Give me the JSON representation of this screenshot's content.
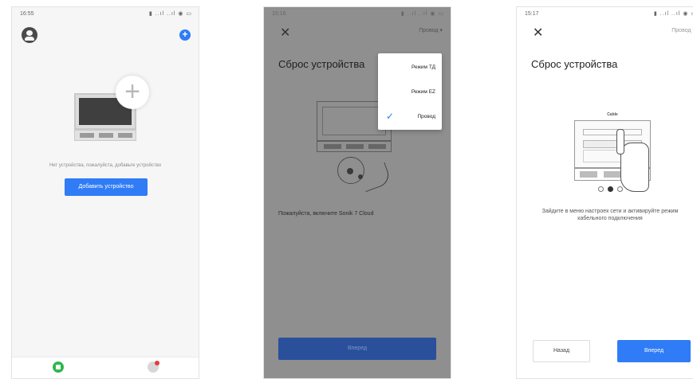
{
  "phone1": {
    "status": {
      "time": "16:55",
      "icons": "▮ ..ıl ..ıl ◉ ▭"
    },
    "empty_text": "Нет устройства, пожалуйста, добавьте устройство",
    "add_device_label": "Добавить устройство",
    "add_plus": "+",
    "big_plus": "+"
  },
  "phone2": {
    "status": {
      "time": "15:16",
      "icons": "▮ ..ıl ..ıl ◉ ▭"
    },
    "close": "✕",
    "mode_link": "Провод ▾",
    "title": "Сброс устройства",
    "instruction": "Пожалуйста, включите Sonik 7 Cloud",
    "forward_label": "Вперед",
    "menu": [
      {
        "label": "Режим ТД",
        "checked": false
      },
      {
        "label": "Режим EZ",
        "checked": false
      },
      {
        "label": "Провод",
        "checked": true
      }
    ],
    "check": "✓"
  },
  "phone3": {
    "status": {
      "time": "15:17",
      "icons": "▮ ..ıl ..ıl ◉ ▭"
    },
    "close": "✕",
    "mode_link": "Провод ▾",
    "title": "Сброс устройства",
    "illus_label": "Cable",
    "instruction": "Зайдите в меню настроек сети и активируйте режим кабельного подключения",
    "back_label": "Назад",
    "forward_label": "Вперед"
  },
  "colors": {
    "accent": "#2f7cf6",
    "home_green": "#2db84d",
    "overlay": "#8f8f8f"
  }
}
